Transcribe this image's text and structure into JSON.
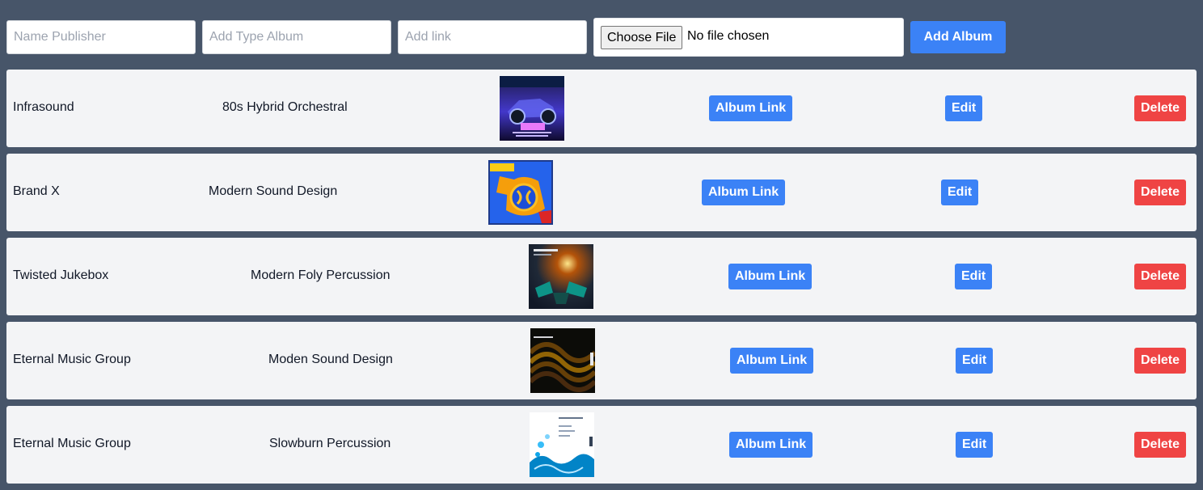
{
  "form": {
    "publisher_placeholder": "Name Publisher",
    "type_placeholder": "Add Type Album",
    "link_placeholder": "Add link",
    "choose_file_label": "Choose File",
    "file_status": "No file chosen",
    "add_album_label": "Add Album"
  },
  "buttons": {
    "album_link": "Album Link",
    "edit": "Edit",
    "delete": "Delete"
  },
  "albums": [
    {
      "publisher": "Infrasound",
      "type": "80s Hybrid Orchestral",
      "cover_art": "neon-motorcycle-cover"
    },
    {
      "publisher": "Brand X",
      "type": "Modern Sound Design",
      "cover_art": "super-x-3-cover"
    },
    {
      "publisher": "Twisted Jukebox",
      "type": "Modern Foly Percussion",
      "cover_art": "hi-percussion-cover"
    },
    {
      "publisher": "Eternal Music Group",
      "type": "Moden Sound Design",
      "cover_art": "gold-wave-cover"
    },
    {
      "publisher": "Eternal Music Group",
      "type": "Slowburn Percussion",
      "cover_art": "water-splash-cover"
    }
  ],
  "colors": {
    "page_background": "#475569",
    "row_background": "#f3f4f6",
    "primary_blue": "#3b82f6",
    "danger_red": "#ef4444"
  }
}
